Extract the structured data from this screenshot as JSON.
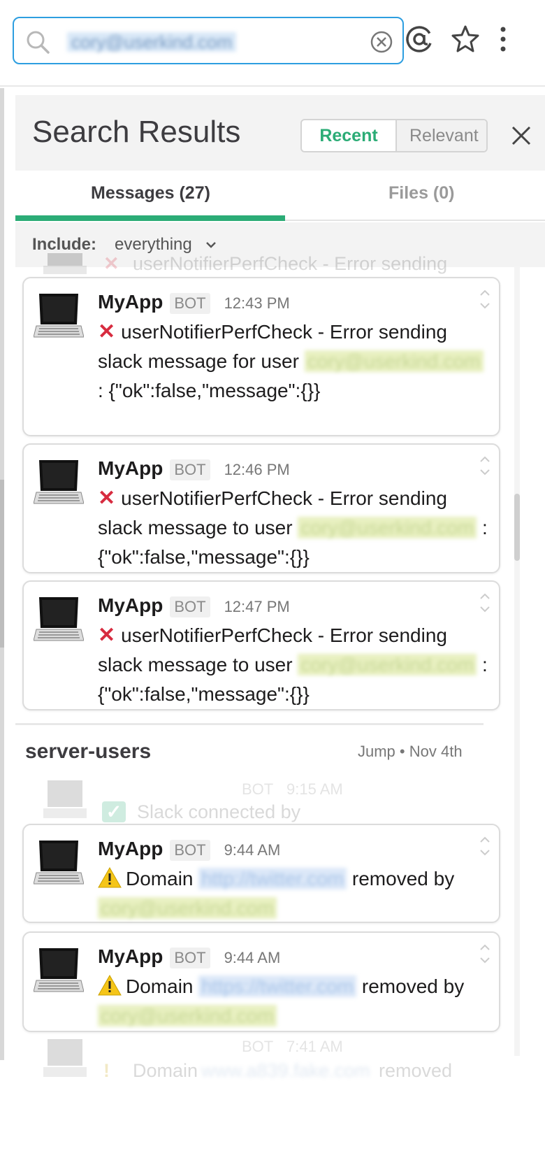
{
  "search": {
    "query": "cory@userkind.com",
    "mention_icon": "at-icon",
    "star_icon": "star-icon",
    "more_icon": "more-vertical-icon"
  },
  "results": {
    "title": "Search Results",
    "sort_recent": "Recent",
    "sort_relevant": "Relevant",
    "tab_messages": "Messages (27)",
    "tab_files": "Files (0)",
    "include_label": "Include:",
    "include_value": "everything"
  },
  "faded_top": {
    "text": "userNotifierPerfCheck - Error sending"
  },
  "cards": [
    {
      "name": "MyApp",
      "badge": "BOT",
      "time": "12:43 PM",
      "prefix": "userNotifierPerfCheck - Error sending slack message for user",
      "email": "cory@userkind.com",
      "suffix": ": {\"ok\":false,\"message\":{}}"
    },
    {
      "name": "MyApp",
      "badge": "BOT",
      "time": "12:46 PM",
      "prefix": "userNotifierPerfCheck - Error sending slack message to user",
      "email": "cory@userkind.com",
      "suffix": ": {\"ok\":false,\"message\":{}}"
    },
    {
      "name": "MyApp",
      "badge": "BOT",
      "time": "12:47 PM",
      "prefix": "userNotifierPerfCheck - Error sending slack message to user",
      "email": "cory@userkind.com",
      "suffix": ": {\"ok\":false,\"message\":{}}"
    }
  ],
  "channel": {
    "name": "server-users",
    "jump": "Jump",
    "date": "Nov 4th"
  },
  "faded_mid": {
    "badge": "BOT",
    "time": "9:15 AM",
    "text": "Slack connected by"
  },
  "domain_cards": [
    {
      "name": "MyApp",
      "badge": "BOT",
      "time": "9:44 AM",
      "prefix": "Domain",
      "url": "http://twitter.com",
      "middle": "removed by",
      "email": "cory@userkind.com"
    },
    {
      "name": "MyApp",
      "badge": "BOT",
      "time": "9:44 AM",
      "prefix": "Domain",
      "url": "https://twitter.com",
      "middle": "removed by",
      "email": "cory@userkind.com"
    }
  ],
  "faded_bottom": {
    "badge": "BOT",
    "time": "7:41 AM",
    "prefix": "Domain",
    "url": "www.a839.fake.com",
    "suffix": "removed"
  }
}
